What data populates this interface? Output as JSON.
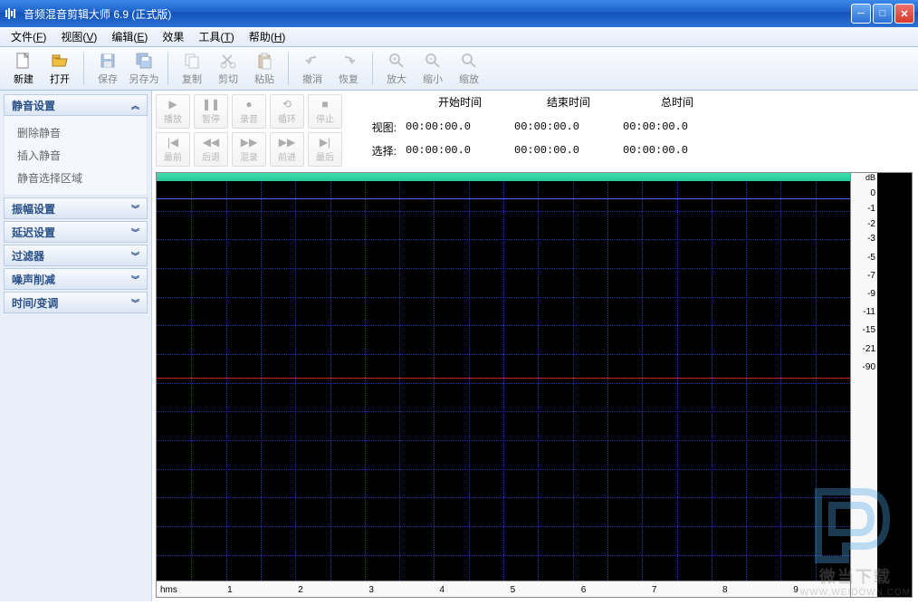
{
  "title": "音频混音剪辑大师 6.9  (正式版)",
  "menus": [
    {
      "label": "文件",
      "key": "F"
    },
    {
      "label": "视图",
      "key": "V"
    },
    {
      "label": "编辑",
      "key": "E"
    },
    {
      "label": "效果",
      "key": ""
    },
    {
      "label": "工具",
      "key": "T"
    },
    {
      "label": "帮助",
      "key": "H"
    }
  ],
  "toolbar": [
    {
      "label": "新建",
      "icon": "new",
      "enabled": true
    },
    {
      "label": "打开",
      "icon": "open",
      "enabled": true
    },
    {
      "sep": true
    },
    {
      "label": "保存",
      "icon": "save",
      "enabled": false
    },
    {
      "label": "另存为",
      "icon": "saveas",
      "enabled": false
    },
    {
      "sep": true
    },
    {
      "label": "复制",
      "icon": "copy",
      "enabled": false
    },
    {
      "label": "剪切",
      "icon": "cut",
      "enabled": false
    },
    {
      "label": "粘贴",
      "icon": "paste",
      "enabled": false
    },
    {
      "sep": true
    },
    {
      "label": "撤消",
      "icon": "undo",
      "enabled": false
    },
    {
      "label": "恢复",
      "icon": "redo",
      "enabled": false
    },
    {
      "sep": true
    },
    {
      "label": "放大",
      "icon": "zoomin",
      "enabled": false
    },
    {
      "label": "缩小",
      "icon": "zoomout",
      "enabled": false
    },
    {
      "label": "缩放",
      "icon": "zoom",
      "enabled": false
    }
  ],
  "sidebar": [
    {
      "title": "静音设置",
      "expanded": true,
      "items": [
        "删除静音",
        "插入静音",
        "静音选择区域"
      ]
    },
    {
      "title": "振幅设置",
      "expanded": false
    },
    {
      "title": "延迟设置",
      "expanded": false
    },
    {
      "title": "过滤器",
      "expanded": false
    },
    {
      "title": "噪声削减",
      "expanded": false
    },
    {
      "title": "时间/变调",
      "expanded": false
    }
  ],
  "transport": {
    "row1": [
      {
        "label": "播放",
        "icon": "▶"
      },
      {
        "label": "暂停",
        "icon": "❚❚"
      },
      {
        "label": "录音",
        "icon": "●"
      },
      {
        "label": "循环",
        "icon": "⟲"
      },
      {
        "label": "停止",
        "icon": "■"
      }
    ],
    "row2": [
      {
        "label": "最前",
        "icon": "|◀"
      },
      {
        "label": "后退",
        "icon": "◀◀"
      },
      {
        "label": "混录",
        "icon": "▶▶"
      },
      {
        "label": "前进",
        "icon": "▶▶"
      },
      {
        "label": "最后",
        "icon": "▶|"
      }
    ]
  },
  "time": {
    "headers": [
      "开始时间",
      "结束时间",
      "总时间"
    ],
    "rows": [
      {
        "label": "视图:",
        "vals": [
          "00:00:00.0",
          "00:00:00.0",
          "00:00:00.0"
        ]
      },
      {
        "label": "选择:",
        "vals": [
          "00:00:00.0",
          "00:00:00.0",
          "00:00:00.0"
        ]
      }
    ]
  },
  "db_scale": {
    "unit": "dB",
    "ticks": [
      0,
      -1,
      -2,
      -3,
      -5,
      -7,
      -9,
      -11,
      -15,
      -21,
      -90
    ]
  },
  "time_axis": {
    "unit": "hms",
    "ticks": [
      1,
      2,
      3,
      4,
      5,
      6,
      7,
      8,
      9
    ]
  },
  "watermark": {
    "text": "微当下载",
    "url": "WWW.WEIDOWN.COM"
  }
}
